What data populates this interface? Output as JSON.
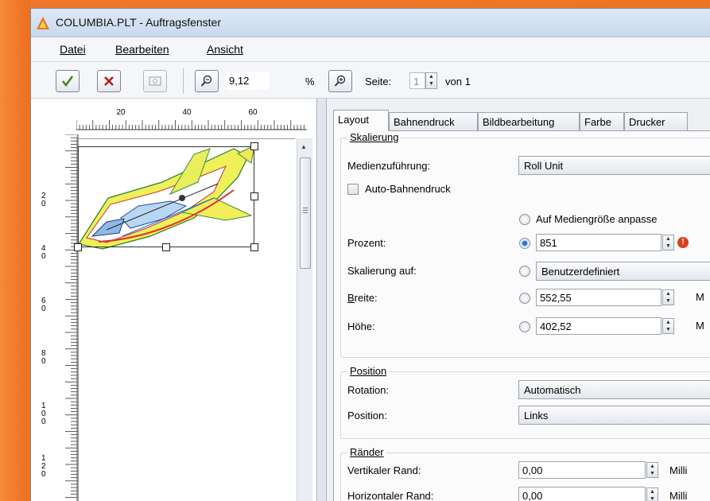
{
  "window": {
    "title": "COLUMBIA.PLT - Auftragsfenster"
  },
  "menu": [
    {
      "label": "Datei"
    },
    {
      "label": "Bearbeiten"
    },
    {
      "label": "Ansicht"
    }
  ],
  "toolbar": {
    "zoom_value": "9,12",
    "zoom_unit": "%",
    "page_label": "Seite:",
    "page_value": "1",
    "page_of": "von 1",
    "icons": [
      "checkmark-icon",
      "cancel-x-icon",
      "preview-icon",
      "zoom-out-icon",
      "zoom-in-icon"
    ]
  },
  "ruler": {
    "top_ticks": [
      "20",
      "40",
      "60"
    ],
    "left_ticks": [
      "2\n0",
      "4\n0",
      "6\n0",
      "8\n0",
      "1\n0\n0",
      "1\n2\n0"
    ]
  },
  "tabs": [
    {
      "label": "Layout"
    },
    {
      "label": "Bahnendruck"
    },
    {
      "label": "Bildbearbeitung"
    },
    {
      "label": "Farbe"
    },
    {
      "label": "Drucker"
    }
  ],
  "skalierung": {
    "title": "Skalierung",
    "medien_label": "Medienzuführung:",
    "medien_value": "Roll Unit",
    "auto_label": "Auto-Bahnendruck",
    "fit_label": "Auf Mediengröße anpasse",
    "prozent_label": "Prozent:",
    "prozent_value": "851",
    "skal_auf_label": "Skalierung auf:",
    "skal_auf_value": "Benutzerdefiniert",
    "breite_label": "Breite:",
    "breite_value": "552,55",
    "breite_unit": "M",
    "hoehe_label": "Höhe:",
    "hoehe_value": "402,52",
    "hoehe_unit": "M"
  },
  "position": {
    "title": "Position",
    "rotation_label": "Rotation:",
    "rotation_value": "Automatisch",
    "position_label": "Position:",
    "position_value": "Links"
  },
  "raender": {
    "title": "Ränder",
    "vert_label": "Vertikaler Rand:",
    "vert_value": "0,00",
    "vert_unit": "Milli",
    "hor_label": "Horizontaler Rand:",
    "hor_value": "0,00",
    "hor_unit": "Milli"
  },
  "colors": {
    "background": "#ee7422",
    "selection": "#2a6fd6",
    "warning": "#d9401c"
  }
}
